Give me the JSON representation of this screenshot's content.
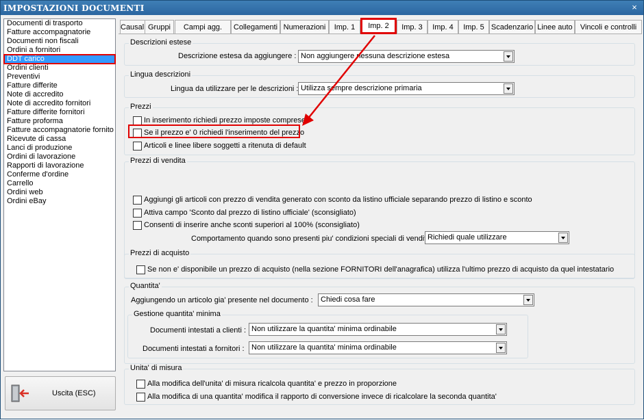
{
  "window": {
    "title": "IMPOSTAZIONI DOCUMENTI",
    "close_glyph": "×"
  },
  "sidebar": {
    "items": [
      "Documenti di trasporto",
      "Fatture accompagnatorie",
      "Documenti non fiscali",
      "Ordini a fornitori",
      "DDT carico",
      "Ordini clienti",
      "Preventivi",
      "Fatture differite",
      "Note di accredito",
      "Note di accredito fornitori",
      "Fatture differite fornitori",
      "Fatture proforma",
      "Fatture accompagnatorie fornito",
      "Ricevute di cassa",
      "Lanci di produzione",
      "Ordini di lavorazione",
      "Rapporti di lavorazione",
      "Conferme d'ordine",
      "Carrello",
      "Ordini web",
      "Ordini eBay"
    ],
    "selected_index": 4
  },
  "exit_button": {
    "label": "Uscita (ESC)",
    "icon": "exit-door-icon"
  },
  "tabs": [
    "Causali",
    "Gruppi",
    "Campi agg.",
    "Collegamenti",
    "Numerazioni",
    "Imp. 1",
    "Imp. 2",
    "Imp. 3",
    "Imp. 4",
    "Imp. 5",
    "Scadenzario",
    "Linee auto",
    "Vincoli e controlli"
  ],
  "active_tab_index": 6,
  "sections": {
    "descrizioni_estese": {
      "title": "Descrizioni estese",
      "field_label": "Descrizione estesa da aggiungere :",
      "value": "Non aggiungere nessuna descrizione estesa"
    },
    "lingua": {
      "title": "Lingua descrizioni",
      "field_label": "Lingua da utilizzare per le descrizioni :",
      "value": "Utilizza sempre descrizione primaria"
    },
    "prezzi": {
      "title": "Prezzi",
      "checks": [
        {
          "label": "In inserimento richiedi prezzo imposte comprese",
          "checked": false
        },
        {
          "label": "Se il prezzo e' 0 richiedi l'inserimento del prezzo",
          "checked": false
        },
        {
          "label": "Articoli e linee libere soggetti a ritenuta di default",
          "checked": false
        }
      ]
    },
    "prezzi_vendita": {
      "title": "Prezzi di vendita",
      "checks": [
        {
          "label": "Aggiungi gli articoli con prezzo di vendita generato con sconto da listino ufficiale separando prezzo di listino e sconto",
          "checked": false
        },
        {
          "label": "Attiva campo 'Sconto dal prezzo di listino ufficiale' (sconsigliato)",
          "checked": false
        },
        {
          "label": "Consenti di inserire anche sconti superiori al 100% (sconsigliato)",
          "checked": false
        }
      ],
      "field_label": "Comportamento quando sono presenti piu' condizioni speciali di vendita valide :",
      "value": "Richiedi quale utilizzare"
    },
    "prezzi_acquisto": {
      "title": "Prezzi di acquisto",
      "checks": [
        {
          "label": "Se non e' disponibile un prezzo di acquisto (nella sezione FORNITORI dell'anagrafica) utilizza l'ultimo prezzo di acquisto da quel intestatario",
          "checked": false
        }
      ]
    },
    "quantita": {
      "title": "Quantita'",
      "field_label": "Aggiungendo un articolo gia' presente nel documento :",
      "value": "Chiedi cosa fare",
      "minima": {
        "title": "Gestione quantita' minima",
        "clienti_label": "Documenti intestati a clienti :",
        "clienti_value": "Non utilizzare la quantita' minima ordinabile",
        "fornitori_label": "Documenti intestati a fornitori :",
        "fornitori_value": "Non utilizzare la quantita' minima ordinabile"
      }
    },
    "unita_misura": {
      "title": "Unita' di misura",
      "checks": [
        {
          "label": "Alla modifica dell'unita' di misura ricalcola quantita' e prezzo in proporzione",
          "checked": false
        },
        {
          "label": "Alla modifica di una quantita' modifica il rapporto di conversione invece di ricalcolare la seconda quantita'",
          "checked": false
        }
      ]
    }
  },
  "colors": {
    "highlight": "#e00000",
    "selection": "#3399ff",
    "titlebar": "#2b66a0"
  }
}
